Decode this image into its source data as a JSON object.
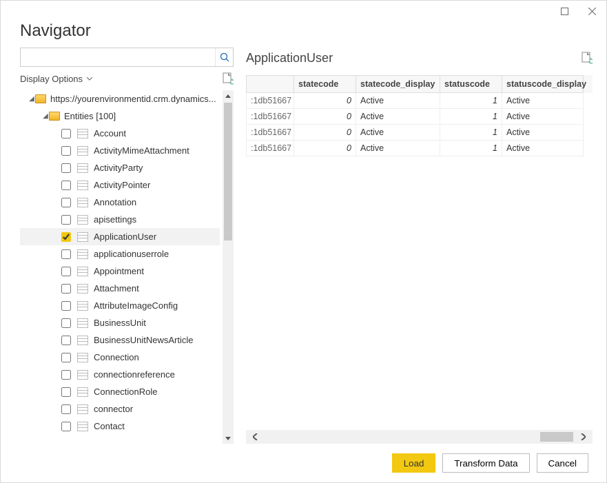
{
  "window": {
    "title": "Navigator"
  },
  "search": {
    "placeholder": ""
  },
  "displayOptions": {
    "label": "Display Options"
  },
  "tree": {
    "root": {
      "label": "https://yourenvironmentid.crm.dynamics..."
    },
    "entitiesFolder": {
      "label": "Entities [100]"
    },
    "entities": [
      {
        "label": "Account",
        "checked": false
      },
      {
        "label": "ActivityMimeAttachment",
        "checked": false
      },
      {
        "label": "ActivityParty",
        "checked": false
      },
      {
        "label": "ActivityPointer",
        "checked": false
      },
      {
        "label": "Annotation",
        "checked": false
      },
      {
        "label": "apisettings",
        "checked": false
      },
      {
        "label": "ApplicationUser",
        "checked": true
      },
      {
        "label": "applicationuserrole",
        "checked": false
      },
      {
        "label": "Appointment",
        "checked": false
      },
      {
        "label": "Attachment",
        "checked": false
      },
      {
        "label": "AttributeImageConfig",
        "checked": false
      },
      {
        "label": "BusinessUnit",
        "checked": false
      },
      {
        "label": "BusinessUnitNewsArticle",
        "checked": false
      },
      {
        "label": "Connection",
        "checked": false
      },
      {
        "label": "connectionreference",
        "checked": false
      },
      {
        "label": "ConnectionRole",
        "checked": false
      },
      {
        "label": "connector",
        "checked": false
      },
      {
        "label": "Contact",
        "checked": false
      }
    ]
  },
  "preview": {
    "title": "ApplicationUser",
    "columns": [
      "",
      "statecode",
      "statecode_display",
      "statuscode",
      "statuscode_display"
    ],
    "rows": [
      {
        "id": ":1db51667",
        "statecode": "0",
        "statecode_display": "Active",
        "statuscode": "1",
        "statuscode_display": "Active"
      },
      {
        "id": ":1db51667",
        "statecode": "0",
        "statecode_display": "Active",
        "statuscode": "1",
        "statuscode_display": "Active"
      },
      {
        "id": ":1db51667",
        "statecode": "0",
        "statecode_display": "Active",
        "statuscode": "1",
        "statuscode_display": "Active"
      },
      {
        "id": ":1db51667",
        "statecode": "0",
        "statecode_display": "Active",
        "statuscode": "1",
        "statuscode_display": "Active"
      }
    ]
  },
  "buttons": {
    "load": "Load",
    "transform": "Transform Data",
    "cancel": "Cancel"
  }
}
